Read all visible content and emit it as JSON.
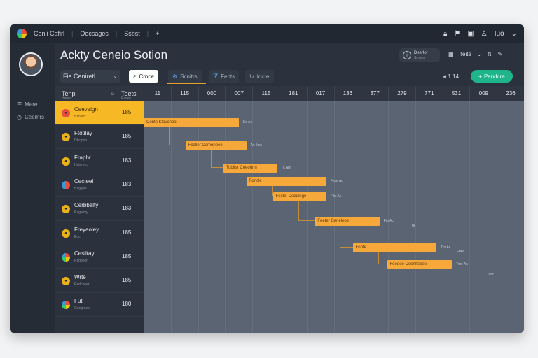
{
  "app": {
    "brand": "Cenli Cafirl",
    "breadcrumb": [
      "Oecsages",
      "Ssbst"
    ],
    "title_icons": [
      "lock-icon",
      "flag-icon",
      "box-icon",
      "user-icon"
    ],
    "user_label": "Iuo"
  },
  "sidebar": {
    "items": [
      {
        "label": "Mere",
        "icon": "list-icon"
      },
      {
        "label": "Ceemrs",
        "icon": "clock-icon"
      }
    ]
  },
  "header": {
    "title": "Ackty Ceneio Sotion",
    "chip_title": "Deerlor",
    "chip_sub": "Smnes",
    "right_label": "Ifeite",
    "right_extra": "⁄⁄"
  },
  "toolbar": {
    "project_select": "Fie Ceniretl",
    "tabs": [
      {
        "label": "Crnce",
        "icon": "search-icon",
        "active": true
      },
      {
        "label": "Scnitrs",
        "icon": "gear-icon",
        "active": false
      },
      {
        "label": "Febts",
        "icon": "filter-icon",
        "active": false
      },
      {
        "label": "Idcre",
        "icon": "refresh-icon",
        "active": false
      }
    ],
    "count": "1 14",
    "add_button": "Pandcre"
  },
  "grid": {
    "task_header": "Tenp",
    "task_sub": "Hanes",
    "time_header": "Teets",
    "time_sub": "Pades",
    "days": [
      "11",
      "115",
      "000",
      "007",
      "115",
      "181",
      "017",
      "136",
      "377",
      "279",
      "771",
      "531",
      "009",
      "236"
    ]
  },
  "tasks": [
    {
      "name": "Ceeveign",
      "sub": "Bsnfect",
      "value": "185",
      "selected": true
    },
    {
      "name": "Ftotilay",
      "sub": "Dhcipsn",
      "value": "185",
      "selected": false
    },
    {
      "name": "Fraphr",
      "sub": "Hatyrerc",
      "value": "183",
      "selected": false
    },
    {
      "name": "Cecteel",
      "sub": "Bagiyes",
      "value": "183",
      "selected": false
    },
    {
      "name": "Cerbbalty",
      "sub": "Ragiemy",
      "value": "183",
      "selected": false
    },
    {
      "name": "Freyaoley",
      "sub": "Eoct",
      "value": "185",
      "selected": false
    },
    {
      "name": "Cesiitay",
      "sub": "Rsqooer",
      "value": "185",
      "selected": false
    },
    {
      "name": "Wrte",
      "sub": "Rerlcoeer",
      "value": "185",
      "selected": false
    },
    {
      "name": "Fut",
      "sub": "Ceegraee",
      "value": "180",
      "selected": false
    }
  ],
  "bars": [
    {
      "text": "Conte Kleuchee",
      "side_label": "Ko Ac",
      "start": 0.0,
      "end": 0.25
    },
    {
      "text": "Fcellor Cemoneee",
      "side_label": "Ac Ikes",
      "start": 0.11,
      "end": 0.27
    },
    {
      "text": "Tobltsr Coeorinn",
      "side_label": "Tk Aie",
      "start": 0.21,
      "end": 0.35
    },
    {
      "text": "Foncle",
      "side_label": "Foce Ac",
      "start": 0.27,
      "end": 0.48
    },
    {
      "text": "Fectel Ceedinge",
      "side_label": "Ftbt Ac",
      "start": 0.34,
      "end": 0.48
    },
    {
      "text": "Feeter Ceneleos",
      "side_label": "Fte Ac",
      "start": 0.45,
      "end": 0.62
    },
    {
      "text": "Fonte",
      "side_label": "Tro Ac",
      "start": 0.55,
      "end": 0.77
    },
    {
      "text": "Foedee Ceenlteeee",
      "side_label": "Tme Ac",
      "start": 0.64,
      "end": 0.81
    }
  ],
  "floating_labels": [
    "Ttle",
    "Ftae",
    "Tcac"
  ]
}
